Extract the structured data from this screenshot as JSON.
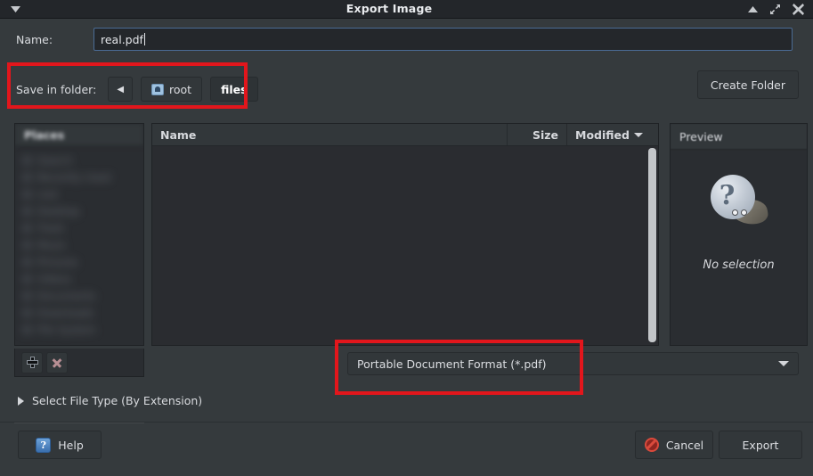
{
  "window": {
    "title": "Export Image",
    "menu_icon": "window-menu-caret-icon",
    "shade_icon": "shade-icon",
    "maximize_icon": "maximize-icon",
    "close_icon": "close-icon"
  },
  "name_row": {
    "label": "Name:",
    "value": "real.pdf"
  },
  "folder_row": {
    "label": "Save in folder:",
    "back_glyph": "◀",
    "crumbs": [
      {
        "label": "root",
        "icon": "home-icon",
        "current": false
      },
      {
        "label": "files",
        "icon": "",
        "current": true
      }
    ],
    "create_folder_label": "Create Folder"
  },
  "places": {
    "header": "Places",
    "items": [
      {
        "label": "Search"
      },
      {
        "label": "Recently Used"
      },
      {
        "label": "root"
      },
      {
        "label": "Desktop"
      },
      {
        "label": "Trash"
      },
      {
        "label": "Music"
      },
      {
        "label": "Pictures"
      },
      {
        "label": "Videos"
      },
      {
        "label": "Documents"
      },
      {
        "label": "Downloads"
      },
      {
        "label": "File System"
      }
    ],
    "add_button": "add-place-button",
    "remove_button": "remove-place-button"
  },
  "file_list": {
    "columns": [
      {
        "key": "name",
        "label": "Name"
      },
      {
        "key": "size",
        "label": "Size"
      },
      {
        "key": "modified",
        "label": "Modified",
        "sort": "descending"
      }
    ],
    "rows": []
  },
  "preview": {
    "header": "Preview",
    "icon": "unknown-file-icon",
    "status": "No selection"
  },
  "file_type_combo": {
    "value": "Portable Document Format (*.pdf)",
    "chevron": "chevron-down-icon"
  },
  "expander": {
    "label": "Select File Type (By Extension)",
    "expanded": false
  },
  "bottom_bar": {
    "help_label": "Help",
    "cancel_label": "Cancel",
    "export_label": "Export"
  },
  "annotations": {
    "color": "#e2161c",
    "boxes": [
      {
        "target": "save-in-folder-row"
      },
      {
        "target": "file-type-combo"
      }
    ]
  }
}
